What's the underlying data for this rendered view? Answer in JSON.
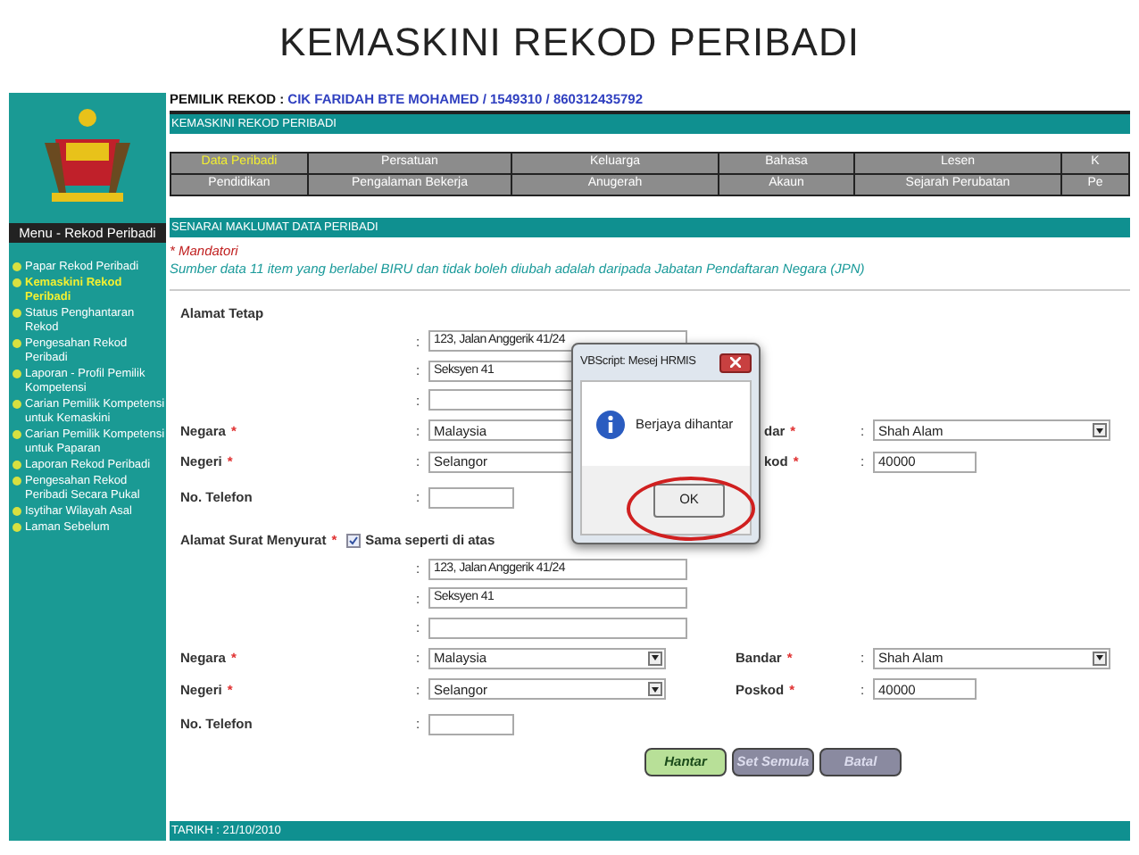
{
  "slide_title": "KEMASKINI REKOD PERIBADI",
  "sidebar": {
    "menu_title": "Menu - Rekod Peribadi",
    "items": [
      {
        "label": "Papar Rekod Peribadi",
        "selected": false
      },
      {
        "label": "Kemaskini Rekod Peribadi",
        "selected": true
      },
      {
        "label": "Status Penghantaran Rekod",
        "selected": false
      },
      {
        "label": "Pengesahan Rekod Peribadi",
        "selected": false
      },
      {
        "label": "Laporan - Profil Pemilik Kompetensi",
        "selected": false
      },
      {
        "label": "Carian Pemilik Kompetensi untuk Kemaskini",
        "selected": false
      },
      {
        "label": "Carian Pemilik Kompetensi untuk Paparan",
        "selected": false
      },
      {
        "label": "Laporan Rekod Peribadi",
        "selected": false
      },
      {
        "label": "Pengesahan Rekod Peribadi Secara Pukal",
        "selected": false
      },
      {
        "label": "Isytihar Wilayah Asal",
        "selected": false
      },
      {
        "label": "Laman Sebelum",
        "selected": false
      }
    ]
  },
  "record_owner": {
    "label": "PEMILIK REKOD :",
    "value": "CIK FARIDAH BTE MOHAMED / 1549310 / 860312435792"
  },
  "page_title": "KEMASKINI REKOD PERIBADI",
  "tab_rows": [
    {
      "tabs": [
        {
          "label": "Data Peribadi",
          "selected": true
        },
        {
          "label": "Persatuan",
          "selected": false
        },
        {
          "label": "Keluarga",
          "selected": false
        },
        {
          "label": "Bahasa",
          "selected": false
        },
        {
          "label": "Lesen",
          "selected": false
        },
        {
          "label": "K",
          "selected": false
        }
      ]
    },
    {
      "tabs": [
        {
          "label": "Pendidikan",
          "selected": false
        },
        {
          "label": "Pengalaman Bekerja",
          "selected": false
        },
        {
          "label": "Anugerah",
          "selected": false
        },
        {
          "label": "Akaun",
          "selected": false
        },
        {
          "label": "Sejarah Perubatan",
          "selected": false
        },
        {
          "label": "Pe",
          "selected": false
        }
      ]
    }
  ],
  "section_title": "SENARAI MAKLUMAT DATA PERIBADI",
  "mandatory_note": "* Mandatori",
  "source_note": "Sumber data 11 item yang berlabel BIRU dan tidak boleh diubah adalah daripada Jabatan Pendaftaran Negara (JPN)",
  "addresses": [
    {
      "heading": "Alamat Tetap",
      "address_lines": [
        {
          "colon": ":",
          "value": "123, Jalan Anggerik 41/24"
        },
        {
          "colon": ":",
          "value": "Seksyen 41"
        },
        {
          "colon": ":"
        }
      ],
      "rows": [
        {
          "left": {
            "label": "Negara",
            "mark": "*",
            "colon": ":",
            "kind": "select",
            "value": "Malaysia"
          },
          "right": {
            "label": "dar",
            "mark": "*",
            "colon": ":",
            "kind": "select",
            "value": "Shah Alam"
          }
        },
        {
          "left": {
            "label": "Negeri",
            "mark": "*",
            "colon": ":",
            "kind": "select",
            "value": "Selangor"
          },
          "right": {
            "label": "kod",
            "mark": "*",
            "colon": ":",
            "kind": "text",
            "value": "40000"
          }
        },
        {
          "left": {
            "label": "No. Telefon",
            "colon": ":",
            "kind": "text"
          }
        }
      ]
    },
    {
      "heading": "Alamat Surat Menyurat",
      "mark": "*",
      "same_as_above": {
        "label": "Sama seperti di atas",
        "checked": true
      },
      "address_lines": [
        {
          "colon": ":",
          "value": "123, Jalan Anggerik 41/24"
        },
        {
          "colon": ":",
          "value": "Seksyen 41"
        },
        {
          "colon": ":"
        }
      ],
      "rows": [
        {
          "left": {
            "label": "Negara",
            "mark": "*",
            "colon": ":",
            "kind": "select",
            "value": "Malaysia"
          },
          "right": {
            "label": "Bandar",
            "mark": "*",
            "colon": ":",
            "kind": "select",
            "value": "Shah Alam"
          }
        },
        {
          "left": {
            "label": "Negeri",
            "mark": "*",
            "colon": ":",
            "kind": "select",
            "value": "Selangor"
          },
          "right": {
            "label": "Poskod",
            "mark": "*",
            "colon": ":",
            "kind": "text",
            "value": "40000"
          }
        },
        {
          "left": {
            "label": "No. Telefon",
            "colon": ":",
            "kind": "text"
          }
        }
      ]
    }
  ],
  "buttons": [
    {
      "label": "Hantar",
      "kind": "primary"
    },
    {
      "label": "Set Semula",
      "kind": "secondary"
    },
    {
      "label": "Batal",
      "kind": "secondary"
    }
  ],
  "footer": "TARIKH : 21/10/2010",
  "dialog": {
    "title": "VBScript: Mesej HRMIS",
    "message": "Berjaya dihantar",
    "button": {
      "label": "OK",
      "highlighted": true
    }
  }
}
